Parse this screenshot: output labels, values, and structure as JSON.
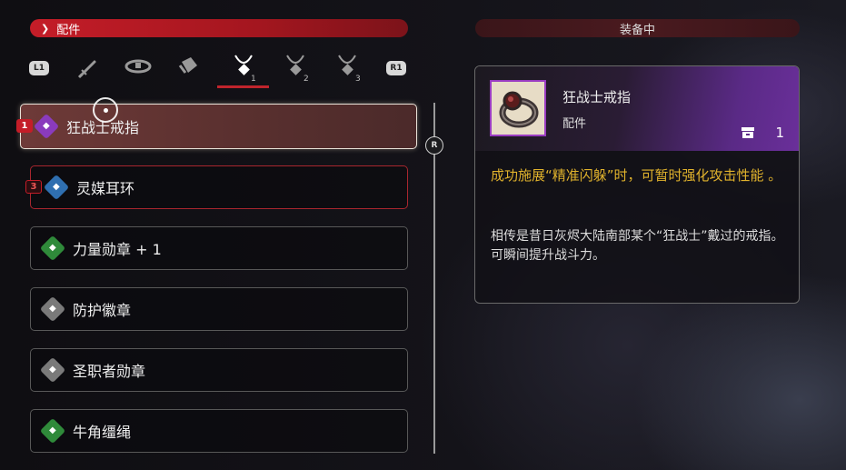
{
  "header": {
    "category_label": "配件",
    "equipped_label": "装备中"
  },
  "tab_bar": {
    "left_button": "L1",
    "right_button": "R1",
    "tabs": [
      {
        "icon": "sword-icon",
        "number": ""
      },
      {
        "icon": "belt-icon",
        "number": ""
      },
      {
        "icon": "gauntlet-icon",
        "number": ""
      },
      {
        "icon": "necklace-icon",
        "number": "1",
        "active": true
      },
      {
        "icon": "necklace-icon",
        "number": "2"
      },
      {
        "icon": "necklace-icon",
        "number": "3"
      }
    ]
  },
  "list": {
    "items": [
      {
        "label": "狂战士戒指",
        "badge": "1",
        "gem_color": "#8a3bbd",
        "selected": true
      },
      {
        "label": "灵媒耳环",
        "badge": "3",
        "gem_color": "#2f6fb0",
        "highlight": true
      },
      {
        "label": "力量勋章 + 1",
        "gem_color": "#2f8a3a"
      },
      {
        "label": "防护徽章",
        "gem_color": "#7a7a7a"
      },
      {
        "label": "圣职者勋章",
        "gem_color": "#7a7a7a"
      },
      {
        "label": "牛角缰绳",
        "gem_color": "#2f8a3a"
      }
    ]
  },
  "scrollbar": {
    "button_label": "R"
  },
  "detail": {
    "name": "狂战士戒指",
    "category": "配件",
    "count": "1",
    "effect": "成功施展“精准闪躲”时，可暂时强化攻击性能 。",
    "lore_line1": "相传是昔日灰烬大陆南部某个“狂战士”戴过的戒指。",
    "lore_line2": "可瞬间提升战斗力。"
  },
  "colors": {
    "accent_red": "#c41d28",
    "effect_text": "#e0b22c",
    "rarity_purple": "#8a3bbd"
  }
}
